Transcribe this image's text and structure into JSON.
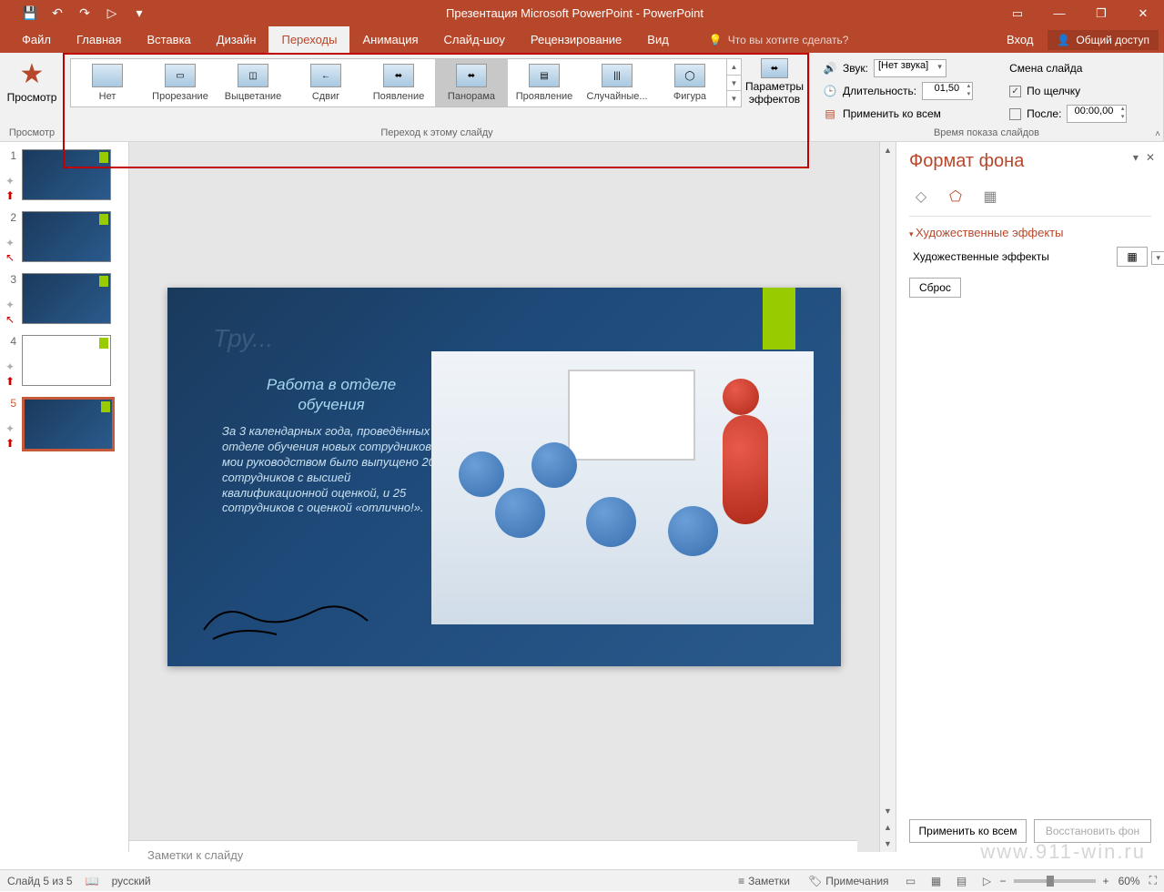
{
  "app_title": "Презентация Microsoft PowerPoint - PowerPoint",
  "qat": {
    "save": "💾",
    "undo": "↶",
    "redo": "↷",
    "start": "▷",
    "more": "▾"
  },
  "tabs": {
    "file": "Файл",
    "home": "Главная",
    "insert": "Вставка",
    "design": "Дизайн",
    "transitions": "Переходы",
    "animations": "Анимация",
    "slideshow": "Слайд-шоу",
    "review": "Рецензирование",
    "view": "Вид"
  },
  "tellme": "Что вы хотите сделать?",
  "login": "Вход",
  "share": "Общий доступ",
  "ribbon": {
    "preview": "Просмотр",
    "preview_group": "Просмотр",
    "gallery": [
      "Нет",
      "Прорезание",
      "Выцветание",
      "Сдвиг",
      "Появление",
      "Панорама",
      "Проявление",
      "Случайные...",
      "Фигура"
    ],
    "gallery_icons": [
      "",
      "▭",
      "◫",
      "←",
      "⬌",
      "⬌",
      "▤",
      "|||",
      "◯"
    ],
    "params": "Параметры эффектов",
    "transition_group": "Переход к этому слайду",
    "sound": "Звук:",
    "sound_val": "[Нет звука]",
    "duration": "Длительность:",
    "duration_val": "01,50",
    "apply_all": "Применить ко всем",
    "advance": "Смена слайда",
    "on_click": "По щелчку",
    "after": "После:",
    "after_val": "00:00,00",
    "timing_group": "Время показа слайдов"
  },
  "slide": {
    "faded_title": "Тру...",
    "subtitle": "Работа в отделе обучения",
    "body": "За 3 календарных года, проведённых в отделе обучения новых сотрудников, под мои руководством было выпущено 20 сотрудников с высшей квалификационной оценкой, и 25 сотрудников с оценкой «отлично!»."
  },
  "notes": "Заметки к слайду",
  "format_pane": {
    "title": "Формат фона",
    "section": "Художественные эффекты",
    "label": "Художественные эффекты",
    "reset": "Сброс",
    "apply_all": "Применить ко всем",
    "restore": "Восстановить фон"
  },
  "status": {
    "slide": "Слайд 5 из 5",
    "lang": "русский",
    "notes": "Заметки",
    "comments": "Примечания",
    "zoom": "60%"
  },
  "thumbnails": [
    1,
    2,
    3,
    4,
    5
  ],
  "selected_thumb": 5,
  "watermark": "www.911-win.ru"
}
